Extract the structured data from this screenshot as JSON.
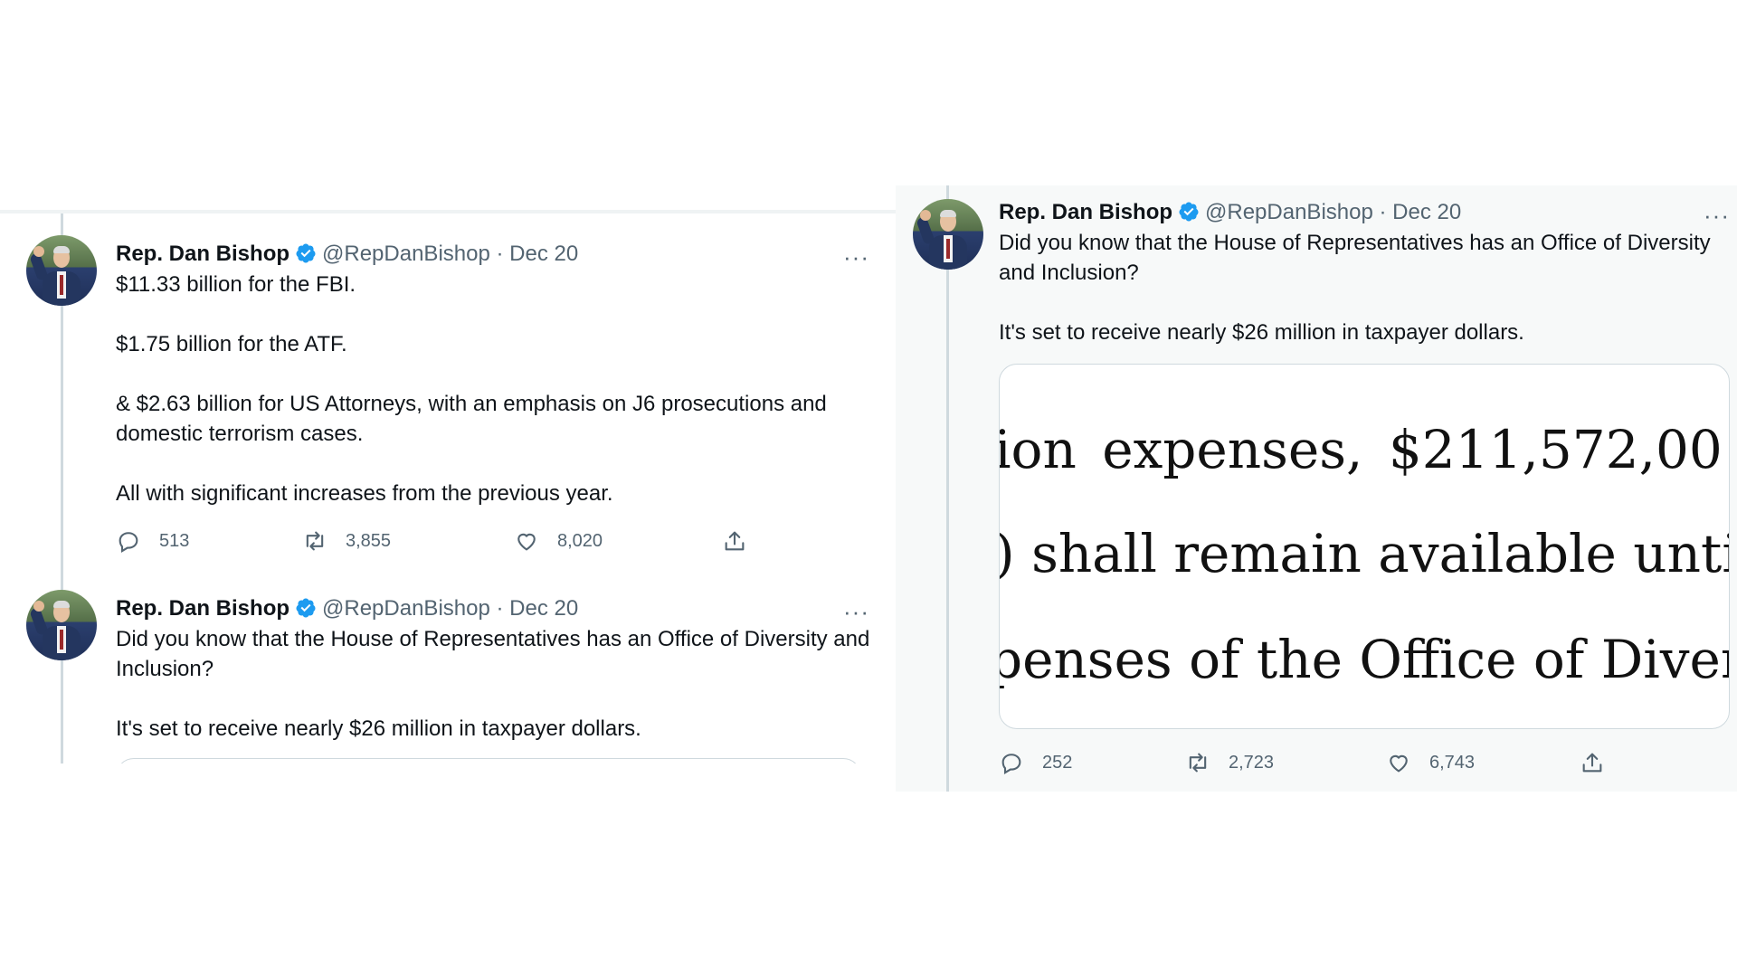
{
  "colors": {
    "verified_badge": "#1d9bf0",
    "secondary_text": "#536471",
    "right_panel_bg": "#f7f9f9"
  },
  "left": {
    "tweet1": {
      "name": "Rep. Dan Bishop",
      "handle": "@RepDanBishop",
      "separator": "·",
      "date": "Dec 20",
      "more": "···",
      "paragraphs": [
        "$11.33 billion for the FBI.",
        "$1.75 billion for the ATF.",
        "& $2.63 billion for US Attorneys, with an emphasis on J6 prosecutions and domestic terrorism cases.",
        "All with significant increases from the previous year."
      ],
      "replies": "513",
      "retweets": "3,855",
      "likes": "8,020"
    },
    "tweet2": {
      "name": "Rep. Dan Bishop",
      "handle": "@RepDanBishop",
      "separator": "·",
      "date": "Dec 20",
      "more": "···",
      "paragraphs": [
        "Did you know that the House of Representatives has an Office of Diversity and Inclusion?",
        "It's set to receive nearly $26 million in taxpayer dollars."
      ]
    }
  },
  "right": {
    "tweet": {
      "name": "Rep. Dan Bishop",
      "handle": "@RepDanBishop",
      "separator": "·",
      "date": "Dec 20",
      "more": "···",
      "paragraphs": [
        "Did you know that the House of Representatives has an Office of Diversity and Inclusion?",
        "It's set to receive nearly $26 million in taxpayer dollars."
      ],
      "image_text": {
        "line1": "ion    expenses,    $211,572,00",
        "line2": ") shall remain available until ex",
        "line3": "penses of the Office of Diversity"
      },
      "replies": "252",
      "retweets": "2,723",
      "likes": "6,743"
    }
  }
}
